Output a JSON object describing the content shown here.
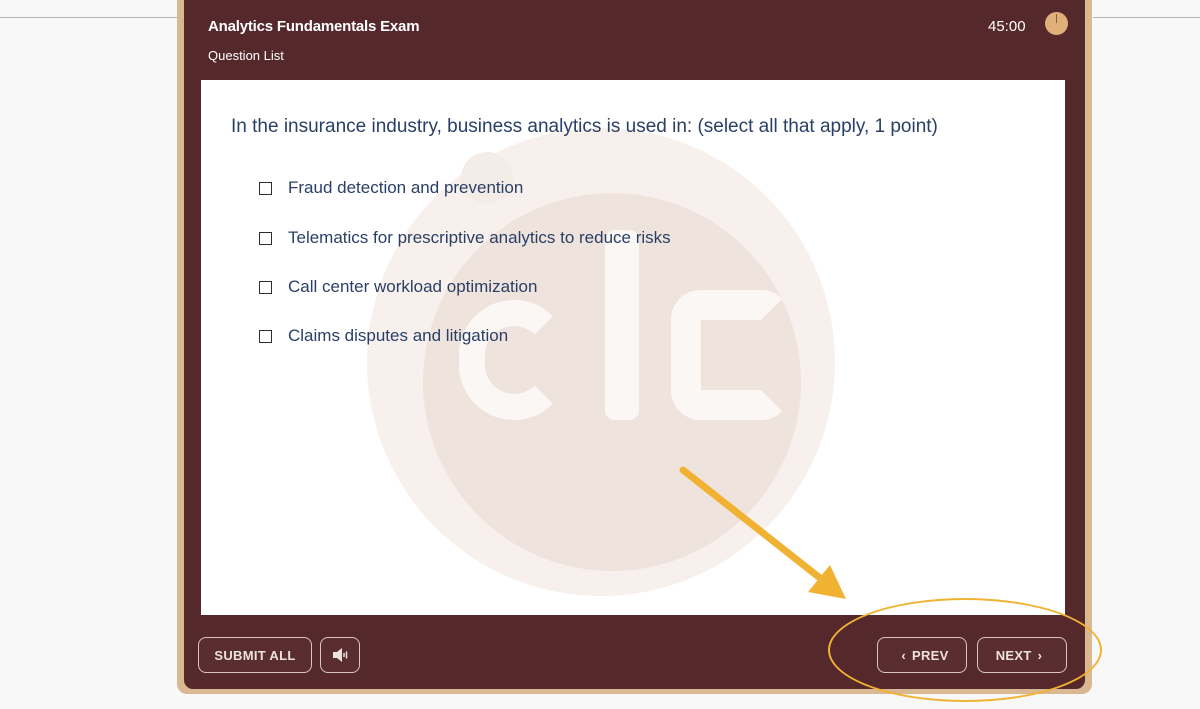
{
  "exam": {
    "title": "Analytics Fundamentals Exam",
    "question_list_label": "Question List",
    "timer": "45:00"
  },
  "question": {
    "text": "In the insurance industry, business analytics is used in: (select all that apply, 1 point)",
    "options": [
      {
        "label": "Fraud detection and prevention",
        "checked": false
      },
      {
        "label": "Telematics for prescriptive analytics to reduce risks",
        "checked": false
      },
      {
        "label": "Call center workload optimization",
        "checked": false
      },
      {
        "label": "Claims disputes and litigation",
        "checked": false
      }
    ]
  },
  "footer": {
    "submit_label": "SUBMIT ALL",
    "prev_label": "PREV",
    "next_label": "NEXT",
    "audio_icon": "speaker-icon"
  },
  "colors": {
    "player_bg": "#55292b",
    "frame": "#dab892",
    "question_text": "#2a3f66",
    "annotation": "#f1b233"
  }
}
